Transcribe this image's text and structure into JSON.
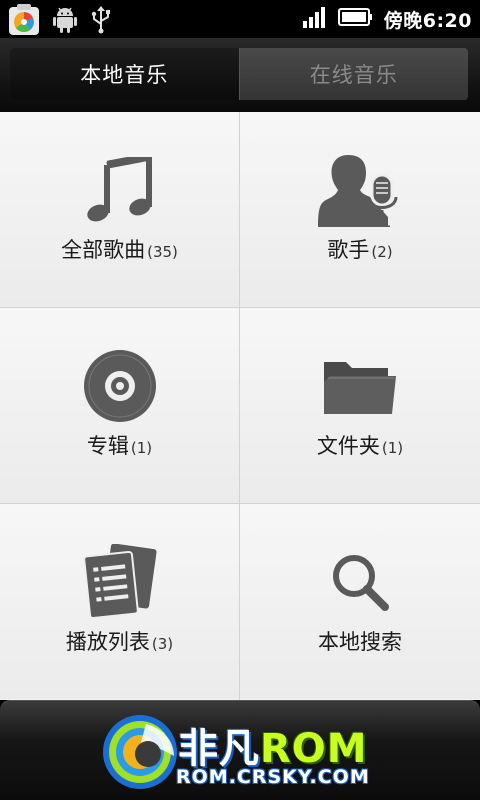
{
  "status_bar": {
    "left_icons": [
      "app-store-icon",
      "android-debug-icon",
      "usb-icon"
    ],
    "right_icons": [
      "signal-icon",
      "battery-icon"
    ],
    "time": "傍晚6:20"
  },
  "tabs": [
    {
      "label": "本地音乐",
      "active": true
    },
    {
      "label": "在线音乐",
      "active": false
    }
  ],
  "grid": [
    {
      "label": "全部歌曲",
      "count": "(35)",
      "icon": "music-note-icon"
    },
    {
      "label": "歌手",
      "count": "(2)",
      "icon": "singer-icon"
    },
    {
      "label": "专辑",
      "count": "(1)",
      "icon": "disc-icon"
    },
    {
      "label": "文件夹",
      "count": "(1)",
      "icon": "folder-icon"
    },
    {
      "label": "播放列表",
      "count": "(3)",
      "icon": "playlist-icon"
    },
    {
      "label": "本地搜索",
      "count": "",
      "icon": "search-icon"
    }
  ],
  "watermark": {
    "brand_cn": "非凡",
    "brand_rom": "ROM",
    "url": "ROM.CRSKY.COM"
  },
  "colors": {
    "icon_gray": "#5a5a5a",
    "cell_bg": "#f0f0f0",
    "tab_active_text": "#ffffff",
    "tab_inactive_text": "#8a8a8a",
    "brand_green": "#c8ff1e",
    "brand_blue": "#1860c0"
  }
}
